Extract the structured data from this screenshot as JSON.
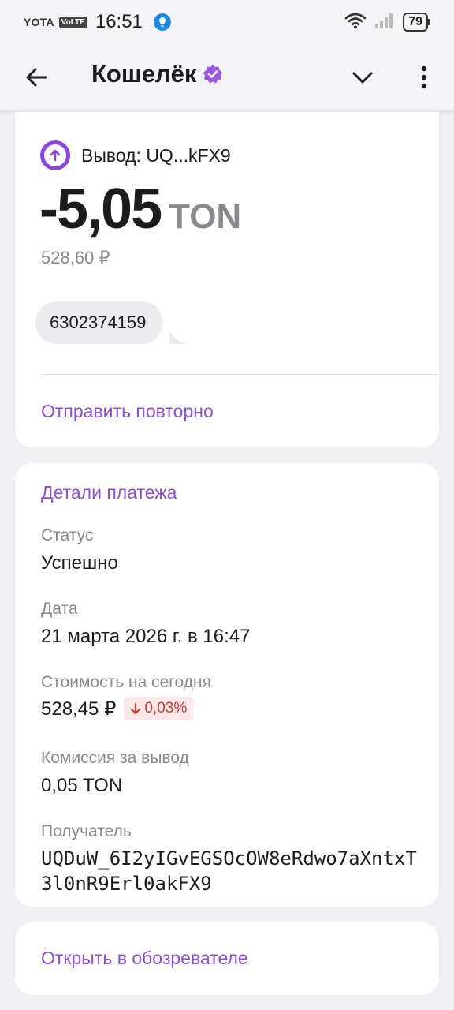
{
  "status_bar": {
    "carrier": "YOTA",
    "volte": "VoLTE",
    "time": "16:51",
    "battery": "79"
  },
  "app_bar": {
    "title": "Кошелёк"
  },
  "transaction": {
    "label": "Вывод: UQ...kFX9",
    "amount": "-5,05",
    "currency": "TON",
    "fiat": "528,60 ₽",
    "comment": "6302374159",
    "resend_label": "Отправить повторно"
  },
  "details": {
    "title": "Детали платежа",
    "status_label": "Статус",
    "status_value": "Успешно",
    "date_label": "Дата",
    "date_value": "21 марта 2026 г. в 16:47",
    "value_label": "Стоимость на сегодня",
    "value_value": "528,45 ₽",
    "value_change": "0,03%",
    "fee_label": "Комиссия за вывод",
    "fee_value": "0,05 TON",
    "recipient_label": "Получатель",
    "recipient_value": "UQDuW_6I2yIGvEGSOcOW8eRdwo7aXntxT3l0nR9Erl0akFX9"
  },
  "explorer": {
    "label": "Открыть в обозревателе"
  },
  "colors": {
    "accent": "#8b4fd4",
    "negative": "#d23b3b",
    "negative_bg": "#fde7e7",
    "background": "#efeff4"
  },
  "icons": [
    "back-arrow-icon",
    "verified-badge-icon",
    "chevron-down-icon",
    "more-vertical-icon",
    "arrow-up-icon",
    "arrow-down-icon",
    "wifi-icon",
    "signal-icon",
    "battery-icon"
  ]
}
